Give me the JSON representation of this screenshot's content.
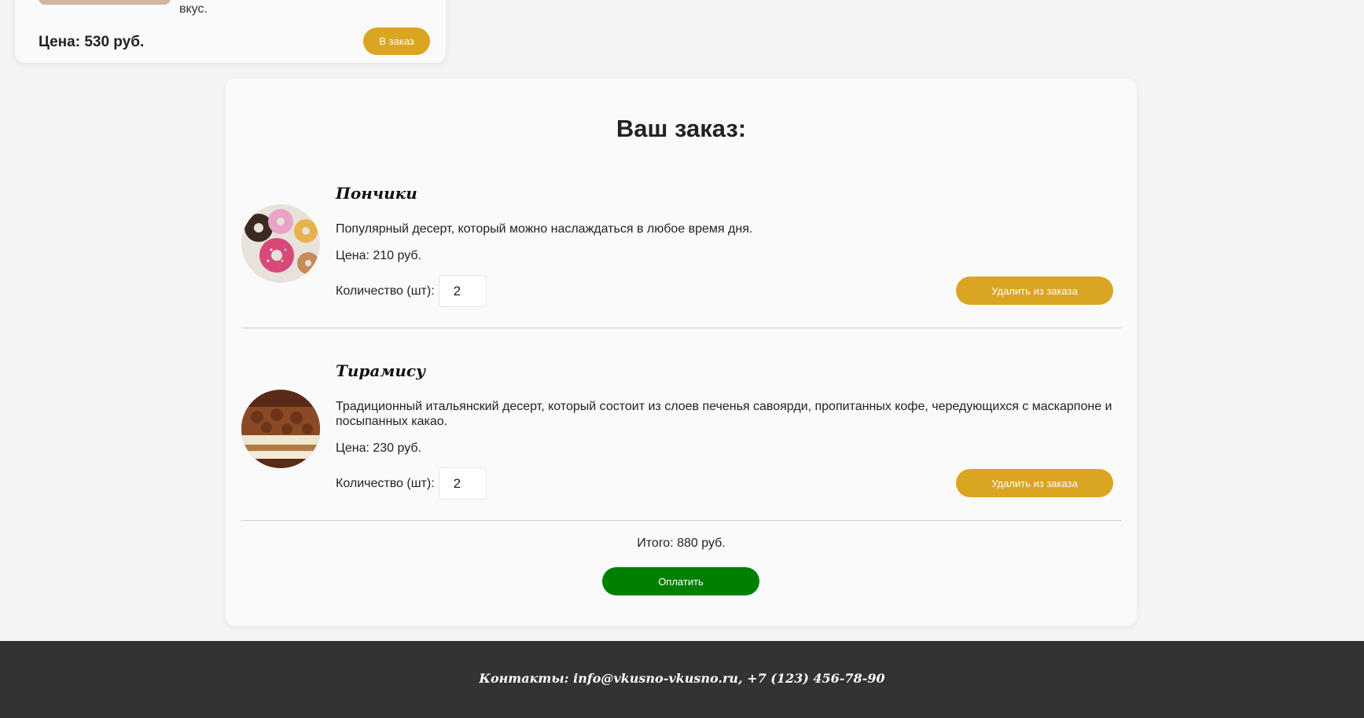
{
  "top_card": {
    "desc_tail": "вкус.",
    "price": "Цена: 530 руб.",
    "order_button": "В заказ"
  },
  "order": {
    "title": "Ваш заказ:",
    "items": [
      {
        "name": "Пончики",
        "description": "Популярный десерт, который можно наслаждаться в любое время дня.",
        "price": "Цена: 210 руб.",
        "qty_label": "Количество (шт):",
        "qty_value": "2",
        "remove_label": "Удалить из заказа",
        "image": "donuts-image"
      },
      {
        "name": "Тирамису",
        "description": "Традиционный итальянский десерт, который состоит из слоев печенья савоярди, пропитанных кофе, чередующихся с маскарпоне и посыпанных какао.",
        "price": "Цена: 230 руб.",
        "qty_label": "Количество (шт):",
        "qty_value": "2",
        "remove_label": "Удалить из заказа",
        "image": "tiramisu-image"
      }
    ],
    "total": "Итого: 880 руб.",
    "pay_label": "Оплатить"
  },
  "footer": {
    "contacts": "Контакты: info@vkusno-vkusno.ru, +7 (123) 456-78-90"
  },
  "colors": {
    "accent_gold": "#daa520",
    "pay_green": "#008000",
    "footer_bg": "#333333",
    "page_bg": "#f4f4f4",
    "panel_bg": "#fafafa"
  }
}
